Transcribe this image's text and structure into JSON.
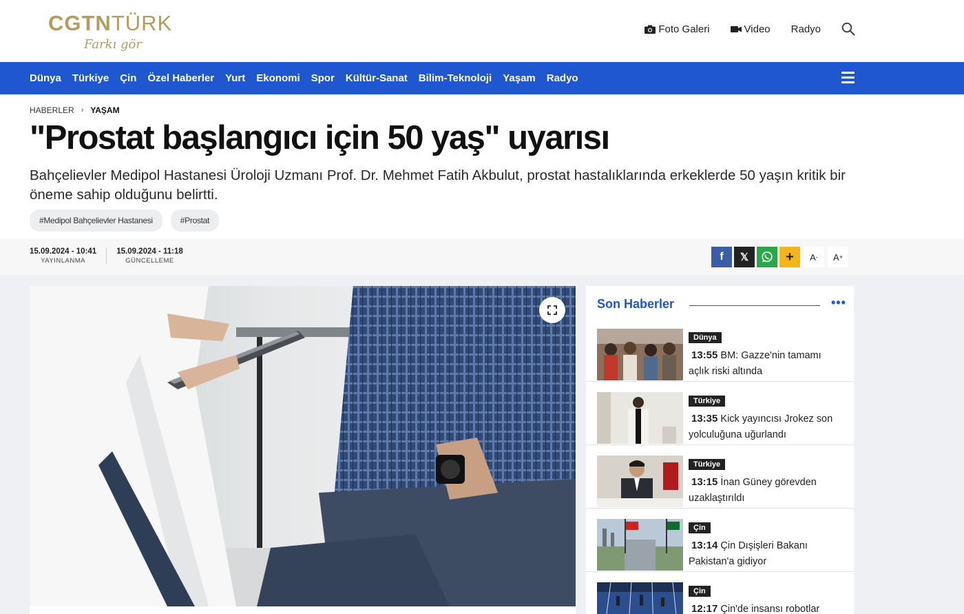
{
  "site": {
    "logo_main_bold": "CGTN",
    "logo_main_light": "TÜRK",
    "logo_tagline": "Farkı gör",
    "top_links": {
      "photo_gallery": "Foto Galeri",
      "video": "Video",
      "radio": "Radyo"
    }
  },
  "nav": {
    "items": [
      "Dünya",
      "Türkiye",
      "Çin",
      "Özel Haberler",
      "Yurt",
      "Ekonomi",
      "Spor",
      "Kültür-Sanat",
      "Bilim-Teknoloji",
      "Yaşam",
      "Radyo"
    ]
  },
  "breadcrumb": {
    "root": "HABERLER",
    "separator": "›",
    "current": "YAŞAM"
  },
  "article": {
    "title": "\"Prostat başlangıcı için 50 yaş\" uyarısı",
    "summary": "Bahçelievler Medipol Hastanesi Üroloji Uzmanı Prof. Dr. Mehmet Fatih Akbulut, prostat hastalıklarında erkeklerde 50 yaşın kritik bir öneme sahip olduğunu belirtti.",
    "tags": [
      "#Medipol Bahçelievler Hastanesi",
      "#Prostat"
    ],
    "published": {
      "value": "15.09.2024 - 10:41",
      "label": "YAYINLANMA"
    },
    "updated": {
      "value": "15.09.2024 - 11:18",
      "label": "GÜNCELLEME"
    }
  },
  "share": {
    "facebook": "f",
    "x": "𝕏",
    "whatsapp": "",
    "more": "+",
    "font_smaller": "A",
    "font_smaller_sign": "-",
    "font_larger": "A",
    "font_larger_sign": "+"
  },
  "sidebar": {
    "title": "Son Haberler",
    "more": "•••",
    "items": [
      {
        "category": "Dünya",
        "time": "13:55",
        "headline": "BM: Gazze'nin tamamı açlık riski altında"
      },
      {
        "category": "Türkiye",
        "time": "13:35",
        "headline": "Kick yayıncısı Jrokez son yolculuğuna uğurlandı"
      },
      {
        "category": "Türkiye",
        "time": "13:15",
        "headline": "İnan Güney görevden uzaklaştırıldı"
      },
      {
        "category": "Çin",
        "time": "13:14",
        "headline": "Çin Dışişleri Bakanı Pakistan'a gidiyor"
      },
      {
        "category": "Çin",
        "time": "12:17",
        "headline": "Çin'de insansı robotlar"
      }
    ]
  },
  "colors": {
    "brand_blue": "#1e57cf",
    "logo_gold": "#b89a5a",
    "facebook": "#3b5ca8",
    "whatsapp": "#2aa64b",
    "plus": "#f3b51a"
  }
}
